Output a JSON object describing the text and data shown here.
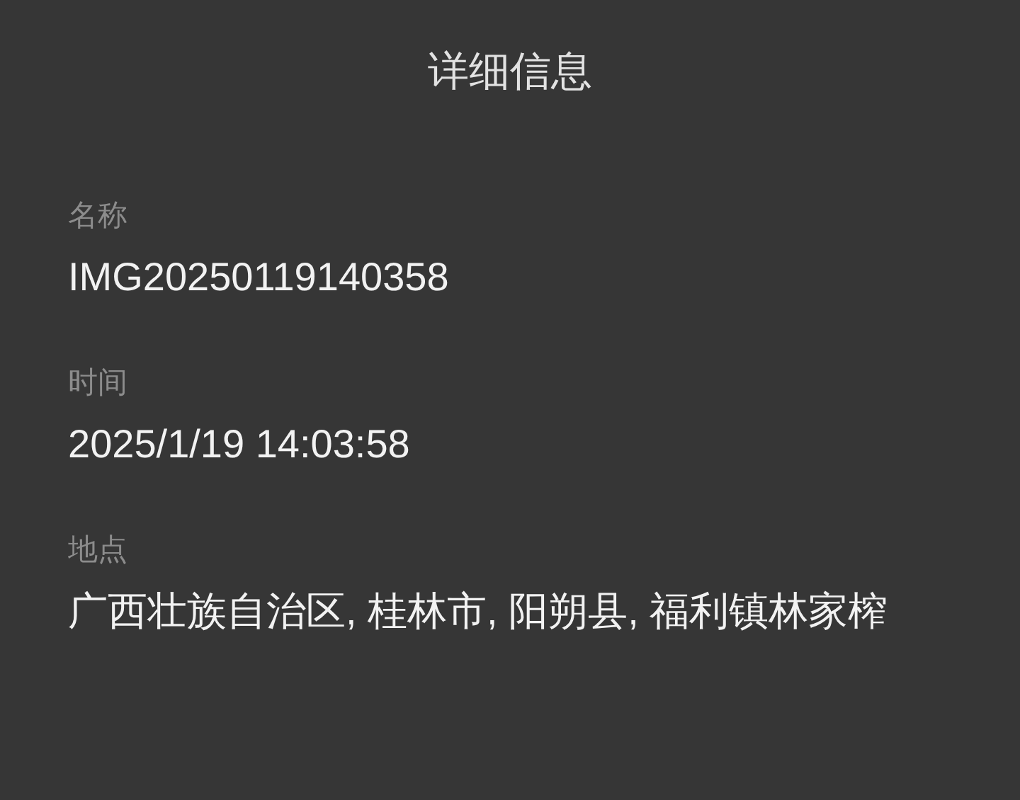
{
  "title": "详细信息",
  "fields": [
    {
      "label": "名称",
      "value": "IMG20250119140358"
    },
    {
      "label": "时间",
      "value": "2025/1/19 14:03:58"
    },
    {
      "label": "地点",
      "value": "广西壮族自治区, 桂林市, 阳朔县, 福利镇林家榨"
    }
  ]
}
